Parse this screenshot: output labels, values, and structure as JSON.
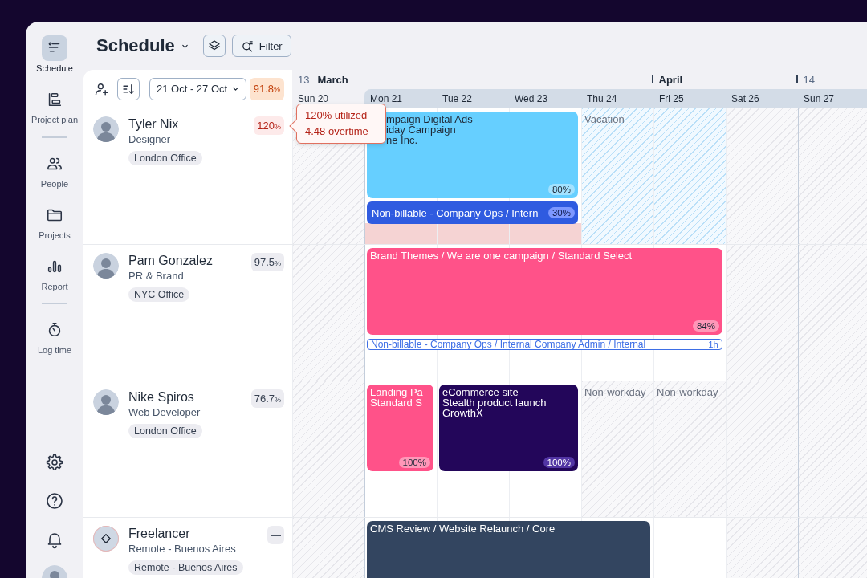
{
  "nav": {
    "items": [
      {
        "kind": "schedule",
        "label": "Schedule",
        "selected": true
      },
      {
        "kind": "plan",
        "label": "Project plan",
        "selected": false
      },
      {
        "kind": "divider"
      },
      {
        "kind": "people",
        "label": "People",
        "selected": false
      },
      {
        "kind": "projects",
        "label": "Projects",
        "selected": false
      },
      {
        "kind": "report",
        "label": "Report",
        "selected": false
      },
      {
        "kind": "divider"
      },
      {
        "kind": "log",
        "label": "Log time",
        "selected": false
      }
    ],
    "footer": [
      {
        "kind": "settings"
      },
      {
        "kind": "help"
      },
      {
        "kind": "notifications"
      },
      {
        "kind": "avatar"
      }
    ]
  },
  "header": {
    "title": "Schedule",
    "filter": "Filter"
  },
  "toolbar": {
    "date_range": "21 Oct - 27 Oct",
    "utilization": {
      "value": "91.8",
      "unit": "%"
    }
  },
  "people": [
    {
      "kind": "member",
      "name": "Tyler Nix",
      "role": "Designer",
      "office": "London Office",
      "overbooked": true,
      "utilization": {
        "value": "120",
        "unit": "%"
      },
      "tooltip": [
        "120% utilized",
        "4.48 overtime"
      ]
    },
    {
      "kind": "member",
      "name": "Pam Gonzalez",
      "role": "PR & Brand",
      "office": "NYC Office",
      "overbooked": false,
      "utilization": {
        "value": "97.5",
        "unit": "%"
      }
    },
    {
      "kind": "member",
      "name": "Nike Spiros",
      "role": "Web Developer",
      "office": "London Office",
      "overbooked": false,
      "utilization": {
        "value": "76.7",
        "unit": "%"
      }
    },
    {
      "kind": "placeholder",
      "name": "Freelancer",
      "role": "Remote - Buenos Aires",
      "office": "Remote - Buenos Aires",
      "overbooked": false,
      "utilization": {
        "value": "—"
      }
    }
  ],
  "calendar": {
    "days": [
      {
        "label": "Sun 20",
        "week": "13",
        "month": "March",
        "in_range": false
      },
      {
        "label": "Mon 21",
        "in_range": true
      },
      {
        "label": "Tue 22",
        "in_range": true
      },
      {
        "label": "Wed 23",
        "in_range": true
      },
      {
        "label": "Thu 24",
        "in_range": true
      },
      {
        "label": "Fri 25",
        "month": "April",
        "in_range": true
      },
      {
        "label": "Sat 26",
        "in_range": true
      },
      {
        "label": "Sun 27",
        "week": "14",
        "in_range": true
      }
    ],
    "rows": [
      {
        "cells": [
          {
            "kind": "off"
          },
          {
            "kind": "overtime",
            "events": [
              {
                "kind": "block",
                "continued": false,
                "color": "#66cfff",
                "lines": [
                  "mpaign Digital Ads",
                  "iday Campaign",
                  "ne Inc."
                ],
                "badge": "80%"
              },
              {
                "kind": "bar",
                "continued": false,
                "color": "#2f5be0",
                "lines": [
                  "Non-billable - Company Ops / Intern"
                ],
                "badge": "30%"
              }
            ]
          },
          {
            "kind": "overtime",
            "events": [
              {
                "continued": true
              },
              {
                "continued": true
              }
            ]
          },
          {
            "kind": "overtime",
            "events": [
              {
                "continued": true
              },
              {
                "continued": true
              }
            ]
          },
          {
            "kind": "vacation",
            "label": "Vacation"
          },
          {
            "kind": "vacation"
          },
          {
            "kind": "off"
          },
          {
            "kind": "off"
          }
        ]
      },
      {
        "cells": [
          {
            "kind": "off"
          },
          {
            "kind": "work",
            "events": [
              {
                "kind": "block",
                "continued": false,
                "color": "#ff5289",
                "lines": [
                  "Brand Themes / We are one campaign / Standard Select"
                ],
                "badge": "84%"
              },
              {
                "kind": "outline",
                "continued": false,
                "color": "#3d6ee6",
                "lines": [
                  "Non-billable - Company Ops / Internal Company Admin / Internal"
                ],
                "badge": "1h"
              }
            ]
          },
          {
            "kind": "work",
            "events": [
              {
                "continued": true
              },
              {
                "continued": true
              }
            ]
          },
          {
            "kind": "work",
            "events": [
              {
                "continued": true
              },
              {
                "continued": true
              }
            ]
          },
          {
            "kind": "work",
            "events": [
              {
                "continued": true
              },
              {
                "continued": true
              }
            ]
          },
          {
            "kind": "work",
            "events": [
              {
                "continued": true
              },
              {
                "continued": true
              }
            ]
          },
          {
            "kind": "off"
          },
          {
            "kind": "off"
          }
        ]
      },
      {
        "cells": [
          {
            "kind": "off"
          },
          {
            "kind": "work",
            "events": [
              {
                "kind": "block",
                "continued": false,
                "color": "#ff5289",
                "lines": [
                  "Landing Pa",
                  "Standard S"
                ],
                "badge": "100%"
              }
            ]
          },
          {
            "kind": "work",
            "events": [
              {
                "kind": "block",
                "continued": false,
                "color": "#23065a",
                "lines": [
                  "eCommerce site",
                  "Stealth product launch",
                  "GrowthX"
                ],
                "badge": "100%"
              }
            ]
          },
          {
            "kind": "work",
            "events": [
              {
                "continued": true
              }
            ]
          },
          {
            "kind": "nonworkday",
            "label": "Non-workday"
          },
          {
            "kind": "nonworkday",
            "label": "Non-workday"
          },
          {
            "kind": "off"
          },
          {
            "kind": "off"
          }
        ]
      },
      {
        "cells": [
          {
            "kind": "off"
          },
          {
            "kind": "work",
            "events": [
              {
                "kind": "block",
                "continued": false,
                "color": "#334560",
                "lines": [
                  "CMS Review / Website Relaunch / Core"
                ]
              }
            ]
          },
          {
            "kind": "work",
            "events": [
              {
                "continued": true
              }
            ]
          },
          {
            "kind": "work",
            "events": [
              {
                "continued": true
              }
            ]
          },
          {
            "kind": "work",
            "events": [
              {
                "continued": true
              }
            ]
          },
          {
            "kind": "work"
          },
          {
            "kind": "off"
          },
          {
            "kind": "off"
          }
        ]
      }
    ]
  }
}
